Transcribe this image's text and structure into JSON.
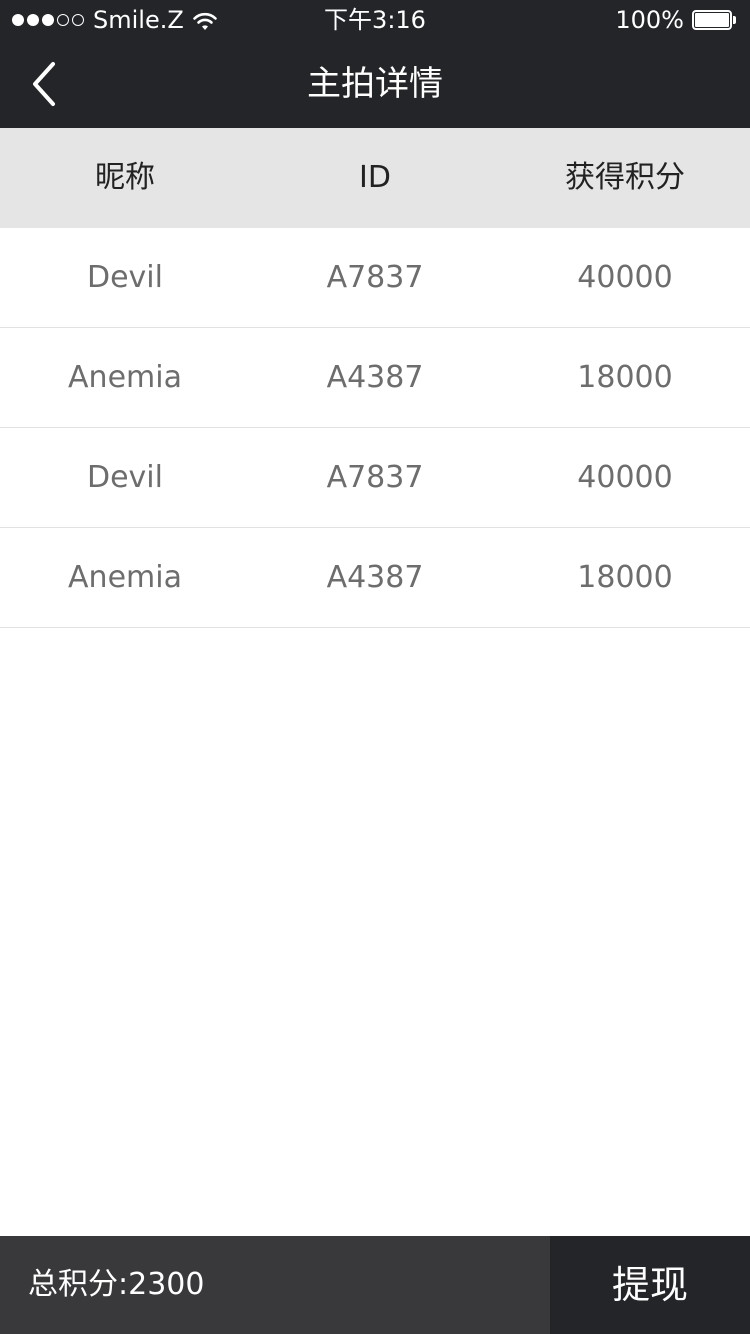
{
  "status_bar": {
    "carrier": "Smile.Z",
    "time": "下午3:16",
    "battery": "100%",
    "signal_filled": 3,
    "signal_total": 5
  },
  "nav": {
    "title": "主拍详情",
    "back_icon": "chevron-left-icon"
  },
  "table": {
    "headers": [
      "昵称",
      "ID",
      "获得积分"
    ],
    "rows": [
      {
        "name": "Devil",
        "id": "A7837",
        "points": "40000"
      },
      {
        "name": "Anemia",
        "id": "A4387",
        "points": "18000"
      },
      {
        "name": "Devil",
        "id": "A7837",
        "points": "40000"
      },
      {
        "name": "Anemia",
        "id": "A4387",
        "points": "18000"
      }
    ]
  },
  "footer": {
    "total_label": "总积分:",
    "total_value": "2300",
    "withdraw_label": "提现"
  },
  "colors": {
    "bar_background": "#242528",
    "header_background": "#e5e5e5",
    "footer_background": "#39393c",
    "cell_text": "#6d6d6d"
  }
}
